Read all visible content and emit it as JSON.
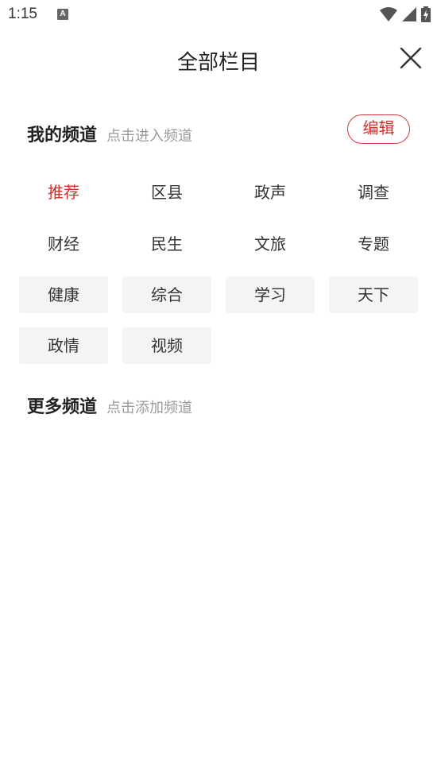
{
  "status_bar": {
    "time": "1:15",
    "indicator": "A",
    "icons": [
      "wifi-icon",
      "signal-icon",
      "battery-charging-icon"
    ]
  },
  "header": {
    "title": "全部栏目",
    "close_icon": "close-icon"
  },
  "my_channels": {
    "title": "我的频道",
    "hint": "点击进入频道",
    "edit_label": "编辑",
    "items": [
      "推荐",
      "区县",
      "政声",
      "调查",
      "财经",
      "民生",
      "文旅",
      "专题",
      "健康",
      "综合",
      "学习",
      "天下",
      "政情",
      "视频"
    ],
    "active_index": 0,
    "boxed_from_index": 8
  },
  "more_channels": {
    "title": "更多频道",
    "hint": "点击添加频道"
  },
  "colors": {
    "accent": "#d0312d",
    "hint": "#9a9a9a",
    "chip_bg": "#f4f4f4"
  }
}
